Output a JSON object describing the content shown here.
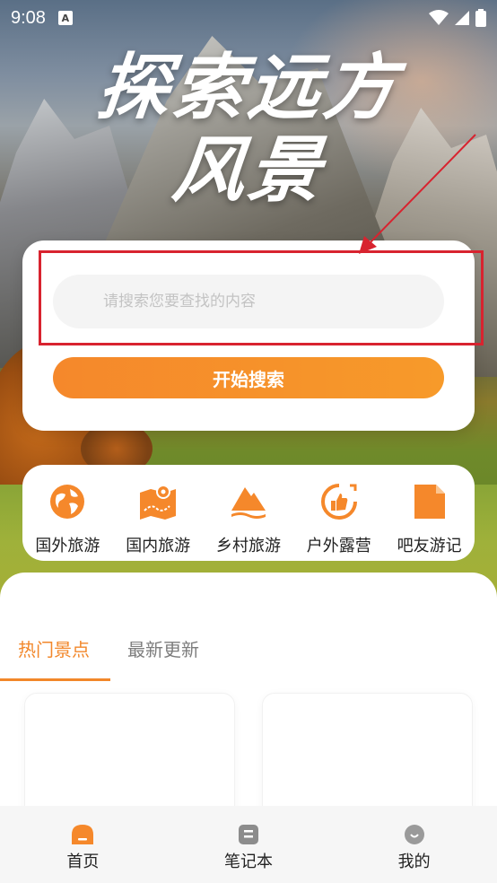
{
  "status_bar": {
    "time": "9:08",
    "a_badge": "A"
  },
  "hero": {
    "title_line1": "探索远方",
    "title_line2": "风景"
  },
  "search": {
    "placeholder": "请搜索您要查找的内容",
    "value": "",
    "button_label": "开始搜索"
  },
  "categories": [
    {
      "label": "国外旅游",
      "icon": "globe-icon"
    },
    {
      "label": "国内旅游",
      "icon": "map-icon"
    },
    {
      "label": "乡村旅游",
      "icon": "mountain-icon"
    },
    {
      "label": "户外露营",
      "icon": "thumbs-up-icon"
    },
    {
      "label": "吧友游记",
      "icon": "document-icon"
    }
  ],
  "tabs": {
    "hot": "热门景点",
    "new": "最新更新"
  },
  "bottom_nav": [
    {
      "label": "首页",
      "icon": "home-icon",
      "active": true
    },
    {
      "label": "笔记本",
      "icon": "notebook-icon",
      "active": false
    },
    {
      "label": "我的",
      "icon": "profile-icon",
      "active": false
    }
  ],
  "colors": {
    "accent": "#F5882B",
    "annotation": "#D8232F"
  }
}
